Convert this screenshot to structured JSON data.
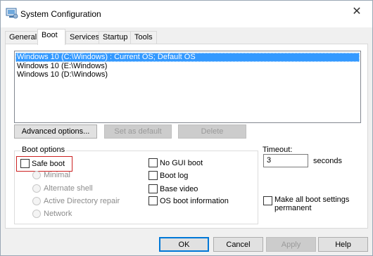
{
  "window": {
    "title": "System Configuration",
    "close_glyph": "✕"
  },
  "tabs": [
    {
      "label": "General"
    },
    {
      "label": "Boot"
    },
    {
      "label": "Services"
    },
    {
      "label": "Startup"
    },
    {
      "label": "Tools"
    }
  ],
  "os_list": [
    "Windows 10 (C:\\Windows) : Current OS; Default OS",
    "Windows 10 (E:\\Windows)",
    "Windows 10 (D:\\Windows)"
  ],
  "list_buttons": {
    "advanced": "Advanced options...",
    "set_default": "Set as default",
    "delete": "Delete"
  },
  "boot_options": {
    "legend": "Boot options",
    "safe_boot": "Safe boot",
    "minimal": "Minimal",
    "alternate_shell": "Alternate shell",
    "ad_repair": "Active Directory repair",
    "network": "Network",
    "no_gui": "No GUI boot",
    "boot_log": "Boot log",
    "base_video": "Base video",
    "os_boot_info": "OS boot information"
  },
  "timeout": {
    "label": "Timeout:",
    "value": "3",
    "unit": "seconds"
  },
  "make_permanent": "Make all boot settings permanent",
  "dialog_buttons": {
    "ok": "OK",
    "cancel": "Cancel",
    "apply": "Apply",
    "help": "Help"
  },
  "colors": {
    "selection": "#3399ff",
    "highlight_border": "#cc2222"
  }
}
